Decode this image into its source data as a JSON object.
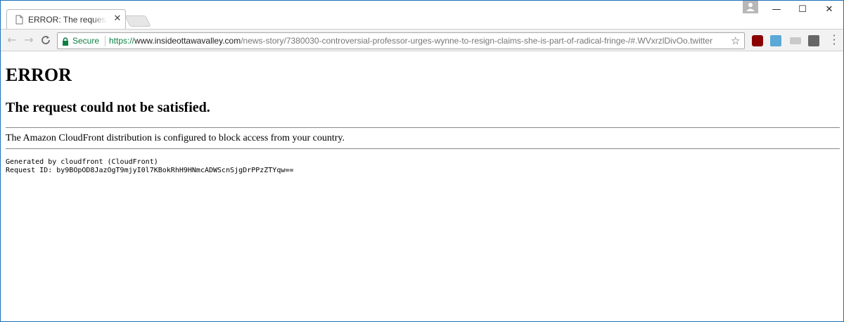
{
  "browser": {
    "tab": {
      "title": "ERROR: The request coul",
      "close_label": "✕",
      "icon": "page-icon"
    },
    "window_controls": {
      "minimize": "—",
      "maximize": "☐",
      "close": "✕"
    },
    "toolbar": {
      "back": "←",
      "forward": "→",
      "reload": "C",
      "secure_label": "Secure",
      "url_scheme": "https://",
      "url_host": "www.insideottawavalley.com",
      "url_path": "/news-story/7380030-controversial-professor-urges-wynne-to-resign-claims-she-is-part-of-radical-fringe-/#.WVxrzlDivOo.twitter",
      "star": "☆",
      "menu": "⋮"
    },
    "extensions": [
      "ublock-icon",
      "s-extension-icon",
      "hd-extension-icon",
      "extension-icon"
    ],
    "colors": {
      "secure_green": "#0b8043",
      "frame_blue": "#1e6fb8"
    }
  },
  "page": {
    "heading": "ERROR",
    "subheading": "The request could not be satisfied.",
    "message": "The Amazon CloudFront distribution is configured to block access from your country.",
    "generated_by": "Generated by cloudfront (CloudFront)",
    "request_id": "Request ID: by9BOpOD8JazOgT9mjyI0l7KBokRhH9HNmcADWScnSjgDrPPzZTYqw=="
  }
}
